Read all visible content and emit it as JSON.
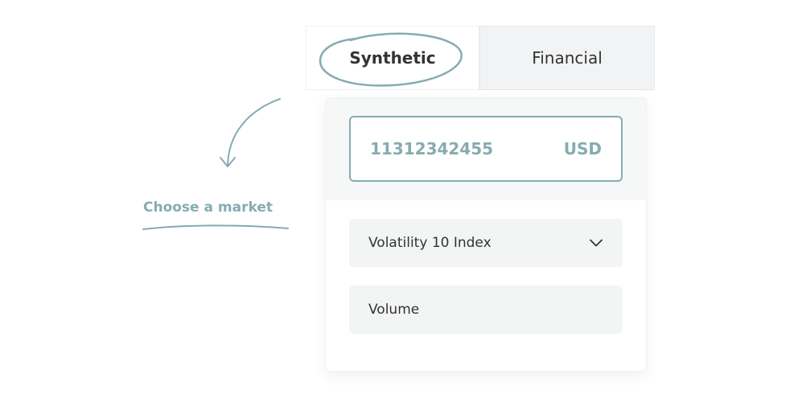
{
  "tabs": {
    "synthetic_label": "Synthetic",
    "financial_label": "Financial",
    "active": "Synthetic"
  },
  "amount": {
    "value": "11312342455",
    "currency": "USD"
  },
  "market_select": {
    "selected": "Volatility 10 Index"
  },
  "volume": {
    "placeholder": "Volume"
  },
  "annotation": {
    "text": "Choose a market"
  },
  "icons": {
    "dropdown": "chevron-down-icon",
    "arrow": "curved-arrow-icon"
  },
  "colors": {
    "accent": "#85acb0",
    "text": "#333333",
    "field_background": "#f3f5f5",
    "inactive_tab": "#f2f3f4"
  }
}
